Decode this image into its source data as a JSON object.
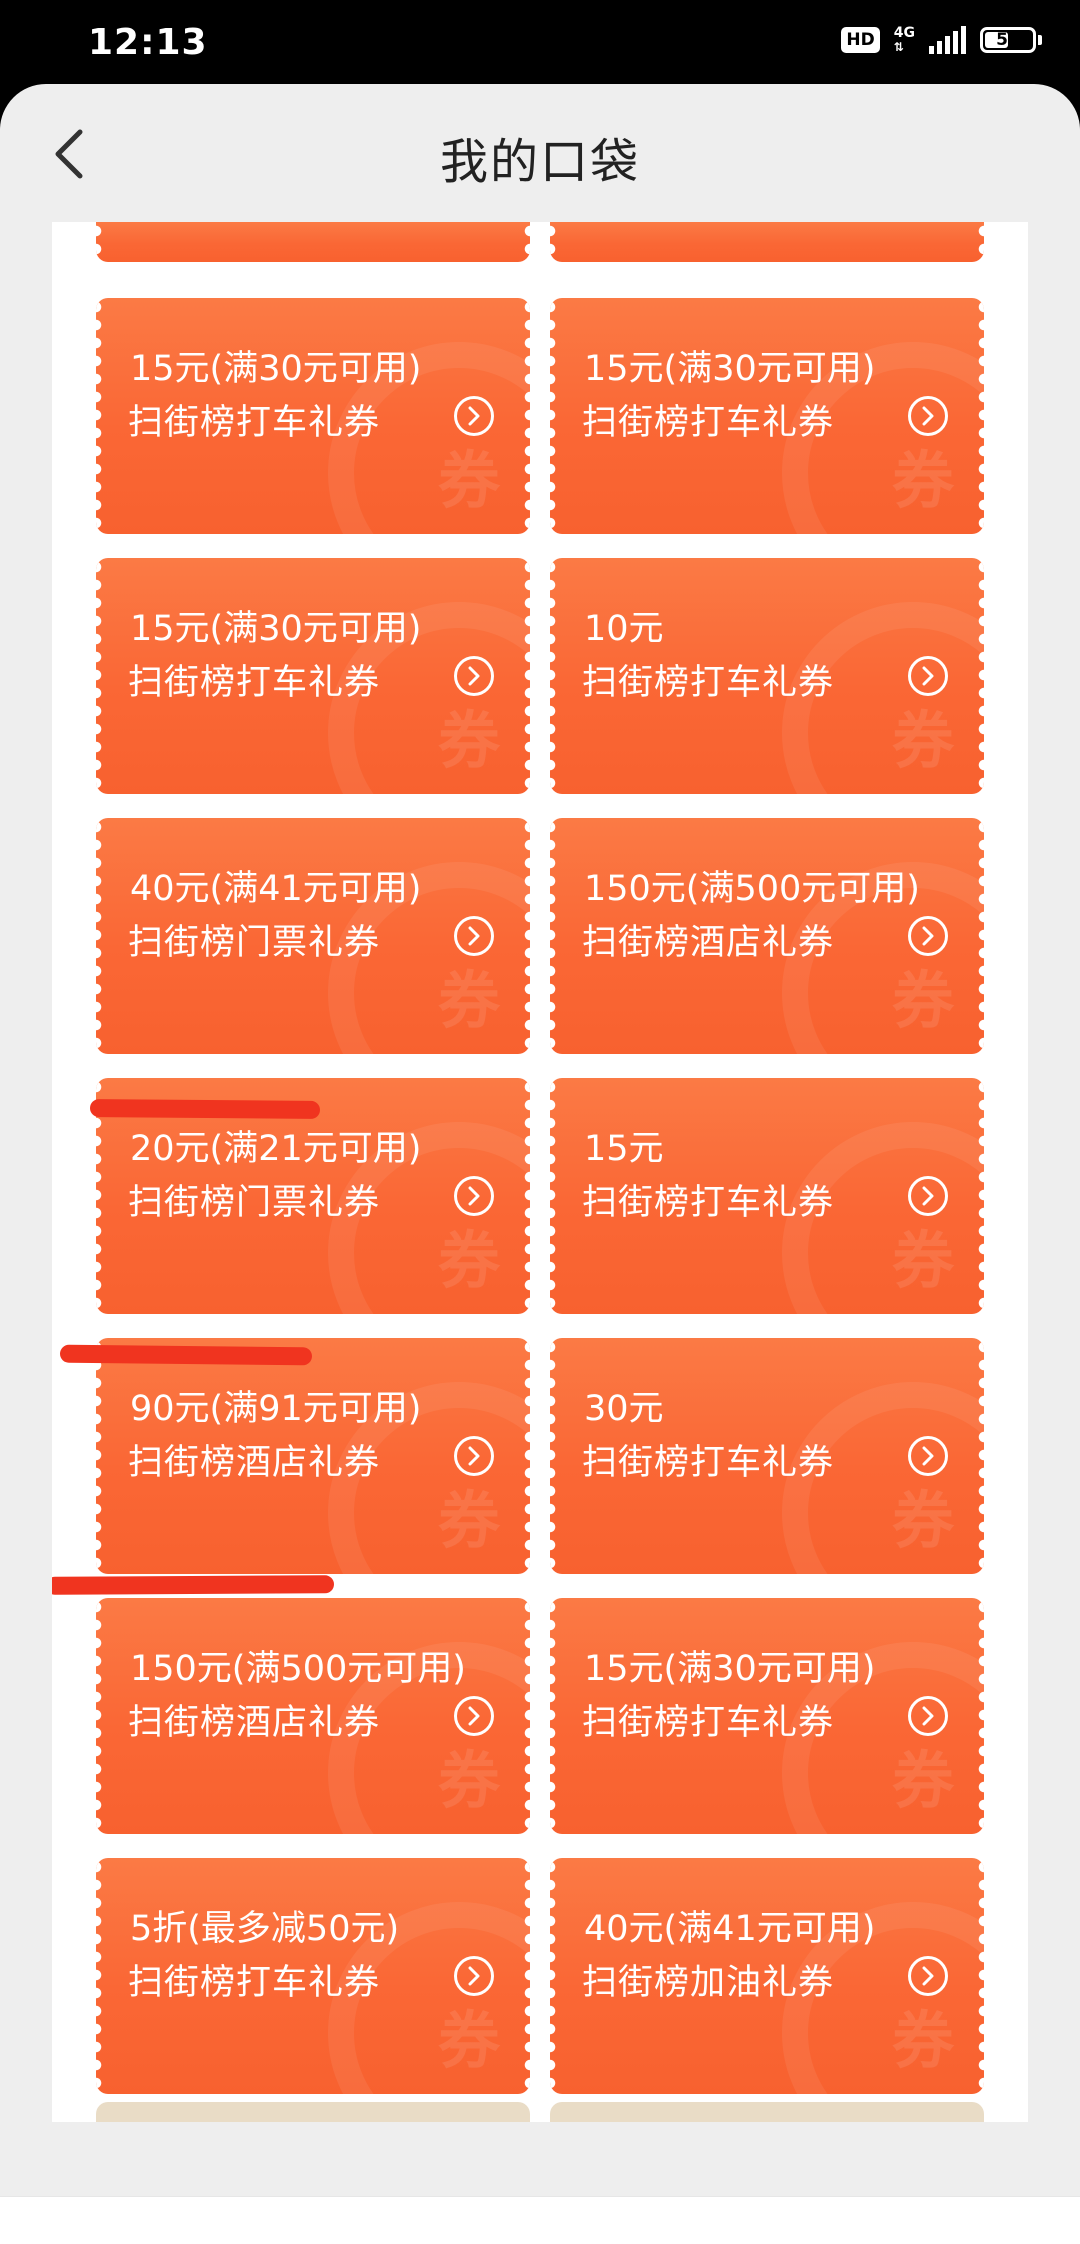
{
  "status_bar": {
    "time": "12:13",
    "hd": "HD",
    "network": "4G",
    "battery": "51",
    "battery_level": 0.51
  },
  "header": {
    "title": "我的口袋"
  },
  "coupons": [
    {
      "amount": "15元(满30元可用)",
      "name": "扫街榜打车礼券"
    },
    {
      "amount": "15元(满30元可用)",
      "name": "扫街榜打车礼券"
    },
    {
      "amount": "15元(满30元可用)",
      "name": "扫街榜打车礼券"
    },
    {
      "amount": "10元",
      "name": "扫街榜打车礼券"
    },
    {
      "amount": "40元(满41元可用)",
      "name": "扫街榜门票礼券"
    },
    {
      "amount": "150元(满500元可用)",
      "name": "扫街榜酒店礼券"
    },
    {
      "amount": "20元(满21元可用)",
      "name": "扫街榜门票礼券"
    },
    {
      "amount": "15元",
      "name": "扫街榜打车礼券"
    },
    {
      "amount": "90元(满91元可用)",
      "name": "扫街榜酒店礼券"
    },
    {
      "amount": "30元",
      "name": "扫街榜打车礼券"
    },
    {
      "amount": "150元(满500元可用)",
      "name": "扫街榜酒店礼券"
    },
    {
      "amount": "15元(满30元可用)",
      "name": "扫街榜打车礼券"
    },
    {
      "amount": "5折(最多减50元)",
      "name": "扫街榜打车礼券"
    },
    {
      "amount": "40元(满41元可用)",
      "name": "扫街榜加油礼券"
    }
  ],
  "coupon_watermark": "券",
  "colors": {
    "coupon": "#fa6735",
    "scribble": "#f0341f",
    "panel": "#ffffff",
    "background": "#eeeeee"
  },
  "icons": {
    "back": "chevron-left-icon",
    "coupon_action": "chevron-right-circle-icon",
    "nav_menu": "menu-icon",
    "nav_home": "square-icon",
    "nav_back": "back-triangle-icon"
  }
}
